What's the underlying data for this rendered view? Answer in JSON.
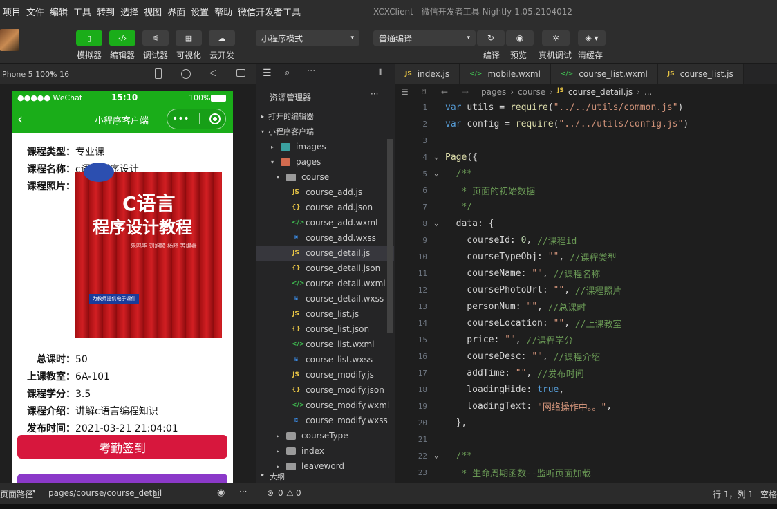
{
  "menubar": {
    "items": [
      "项目",
      "文件",
      "编辑",
      "工具",
      "转到",
      "选择",
      "视图",
      "界面",
      "设置",
      "帮助",
      "微信开发者工具"
    ],
    "title": "XCXClient - 微信开发者工具 Nightly 1.05.2104012"
  },
  "toolbar": {
    "left_buttons": [
      {
        "label": "模拟器",
        "icon": "phone-icon"
      },
      {
        "label": "编辑器",
        "icon": "code-icon"
      },
      {
        "label": "调试器",
        "icon": "debug-sliders-icon"
      },
      {
        "label": "可视化",
        "icon": "layout-icon"
      },
      {
        "label": "云开发",
        "icon": "cloud-icon"
      }
    ],
    "mode_select": "小程序模式",
    "compile_select": "普通编译",
    "right_buttons": [
      {
        "label": "编译",
        "icon": "refresh-icon"
      },
      {
        "label": "预览",
        "icon": "eye-icon"
      },
      {
        "label": "真机调试",
        "icon": "bug-icon"
      },
      {
        "label": "清缓存",
        "icon": "layers-icon"
      }
    ]
  },
  "simulator": {
    "device": "iPhone 5 100% 16",
    "status_carrier": "●●●●● WeChat",
    "status_time": "15:10",
    "status_battery": "100%",
    "nav_title": "小程序客户端",
    "fields": [
      {
        "label": "课程类型：",
        "value": "专业课"
      },
      {
        "label": "课程名称：",
        "value": "c语言程序设计"
      },
      {
        "label": "课程照片：",
        "value": ""
      }
    ],
    "book": {
      "line1": "C语言",
      "line2": "程序设计教程",
      "authors": "朱鸣华 刘旭麟 杨晓 等编著",
      "badge": "为教师提供电子课件"
    },
    "fields2": [
      {
        "label": "总课时：",
        "value": "50"
      },
      {
        "label": "上课教室：",
        "value": "6A-101"
      },
      {
        "label": "课程学分：",
        "value": "3.5"
      },
      {
        "label": "课程介绍：",
        "value": "讲解c语言编程知识"
      },
      {
        "label": "发布时间：",
        "value": "2021-03-21 21:04:01"
      }
    ],
    "checkin_button": "考勤签到",
    "bottom_path_label": "页面路径",
    "bottom_path": "pages/course/course_detail"
  },
  "explorer": {
    "title": "资源管理器",
    "sections": {
      "open_editors": "打开的编辑器",
      "project": "小程序客户端",
      "outline": "大纲"
    },
    "tree": [
      {
        "name": "images",
        "type": "folder",
        "depth": 1
      },
      {
        "name": "pages",
        "type": "folder-open",
        "depth": 1
      },
      {
        "name": "course",
        "type": "folder-open",
        "depth": 2
      },
      {
        "name": "course_add.js",
        "type": "js",
        "depth": 3
      },
      {
        "name": "course_add.json",
        "type": "json",
        "depth": 3
      },
      {
        "name": "course_add.wxml",
        "type": "wxml",
        "depth": 3
      },
      {
        "name": "course_add.wxss",
        "type": "wxss",
        "depth": 3
      },
      {
        "name": "course_detail.js",
        "type": "js",
        "depth": 3,
        "selected": true
      },
      {
        "name": "course_detail.json",
        "type": "json",
        "depth": 3
      },
      {
        "name": "course_detail.wxml",
        "type": "wxml",
        "depth": 3
      },
      {
        "name": "course_detail.wxss",
        "type": "wxss",
        "depth": 3
      },
      {
        "name": "course_list.js",
        "type": "js",
        "depth": 3
      },
      {
        "name": "course_list.json",
        "type": "json",
        "depth": 3
      },
      {
        "name": "course_list.wxml",
        "type": "wxml",
        "depth": 3
      },
      {
        "name": "course_list.wxss",
        "type": "wxss",
        "depth": 3
      },
      {
        "name": "course_modify.js",
        "type": "js",
        "depth": 3
      },
      {
        "name": "course_modify.json",
        "type": "json",
        "depth": 3
      },
      {
        "name": "course_modify.wxml",
        "type": "wxml",
        "depth": 3
      },
      {
        "name": "course_modify.wxss",
        "type": "wxss",
        "depth": 3
      },
      {
        "name": "courseType",
        "type": "folder",
        "depth": 2
      },
      {
        "name": "index",
        "type": "folder",
        "depth": 2
      },
      {
        "name": "leaveword",
        "type": "folder",
        "depth": 2
      }
    ]
  },
  "editor": {
    "tabs": [
      "index.js",
      "mobile.wxml",
      "course_list.wxml",
      "course_list.js"
    ],
    "breadcrumb": [
      "pages",
      "course",
      "course_detail.js",
      "..."
    ],
    "lines": [
      {
        "n": "1",
        "t": [
          [
            "kw",
            "var "
          ],
          [
            "pl",
            "utils = "
          ],
          [
            "fn",
            "require"
          ],
          [
            "pl",
            "("
          ],
          [
            "str",
            "\"../../utils/common.js\""
          ],
          [
            "pl",
            ")"
          ]
        ]
      },
      {
        "n": "2",
        "t": [
          [
            "kw",
            "var "
          ],
          [
            "pl",
            "config = "
          ],
          [
            "fn",
            "require"
          ],
          [
            "pl",
            "("
          ],
          [
            "str",
            "\"../../utils/config.js\""
          ],
          [
            "pl",
            ")"
          ]
        ]
      },
      {
        "n": "3",
        "t": []
      },
      {
        "n": "4",
        "t": [
          [
            "fn",
            "Page"
          ],
          [
            "pl",
            "({"
          ]
        ],
        "fold": true
      },
      {
        "n": "5",
        "t": [
          [
            "cm",
            "  /**"
          ]
        ],
        "fold": true
      },
      {
        "n": "6",
        "t": [
          [
            "cm",
            "   * 页面的初始数据"
          ]
        ]
      },
      {
        "n": "7",
        "t": [
          [
            "cm",
            "   */"
          ]
        ]
      },
      {
        "n": "8",
        "t": [
          [
            "pl",
            "  data: {"
          ]
        ],
        "fold": true
      },
      {
        "n": "9",
        "t": [
          [
            "pl",
            "    courseId: "
          ],
          [
            "num",
            "0"
          ],
          [
            "pl",
            ", "
          ],
          [
            "cm",
            "//课程id"
          ]
        ]
      },
      {
        "n": "10",
        "t": [
          [
            "pl",
            "    courseTypeObj: "
          ],
          [
            "str",
            "\"\""
          ],
          [
            "pl",
            ", "
          ],
          [
            "cm",
            "//课程类型"
          ]
        ]
      },
      {
        "n": "11",
        "t": [
          [
            "pl",
            "    courseName: "
          ],
          [
            "str",
            "\"\""
          ],
          [
            "pl",
            ", "
          ],
          [
            "cm",
            "//课程名称"
          ]
        ]
      },
      {
        "n": "12",
        "t": [
          [
            "pl",
            "    coursePhotoUrl: "
          ],
          [
            "str",
            "\"\""
          ],
          [
            "pl",
            ", "
          ],
          [
            "cm",
            "//课程照片"
          ]
        ]
      },
      {
        "n": "13",
        "t": [
          [
            "pl",
            "    personNum: "
          ],
          [
            "str",
            "\"\""
          ],
          [
            "pl",
            ", "
          ],
          [
            "cm",
            "//总课时"
          ]
        ]
      },
      {
        "n": "14",
        "t": [
          [
            "pl",
            "    courseLocation: "
          ],
          [
            "str",
            "\"\""
          ],
          [
            "pl",
            ", "
          ],
          [
            "cm",
            "//上课教室"
          ]
        ]
      },
      {
        "n": "15",
        "t": [
          [
            "pl",
            "    price: "
          ],
          [
            "str",
            "\"\""
          ],
          [
            "pl",
            ", "
          ],
          [
            "cm",
            "//课程学分"
          ]
        ]
      },
      {
        "n": "16",
        "t": [
          [
            "pl",
            "    courseDesc: "
          ],
          [
            "str",
            "\"\""
          ],
          [
            "pl",
            ", "
          ],
          [
            "cm",
            "//课程介绍"
          ]
        ]
      },
      {
        "n": "17",
        "t": [
          [
            "pl",
            "    addTime: "
          ],
          [
            "str",
            "\"\""
          ],
          [
            "pl",
            ", "
          ],
          [
            "cm",
            "//发布时间"
          ]
        ]
      },
      {
        "n": "18",
        "t": [
          [
            "pl",
            "    loadingHide: "
          ],
          [
            "kw",
            "true"
          ],
          [
            "pl",
            ","
          ]
        ]
      },
      {
        "n": "19",
        "t": [
          [
            "pl",
            "    loadingText: "
          ],
          [
            "str",
            "\"网络操作中。。\""
          ],
          [
            "pl",
            ","
          ]
        ]
      },
      {
        "n": "20",
        "t": [
          [
            "pl",
            "  },"
          ]
        ]
      },
      {
        "n": "21",
        "t": []
      },
      {
        "n": "22",
        "t": [
          [
            "cm",
            "  /**"
          ]
        ],
        "fold": true
      },
      {
        "n": "23",
        "t": [
          [
            "cm",
            "   * 生命周期函数--监听页面加载"
          ]
        ]
      }
    ]
  },
  "statusbar": {
    "errors": "0",
    "warnings": "0",
    "position": "行 1，列 1",
    "spaces": "空格"
  },
  "colors": {
    "wechat_green": "#1aad19",
    "checkin_red": "#d7173d",
    "purple": "#8b39c9"
  }
}
